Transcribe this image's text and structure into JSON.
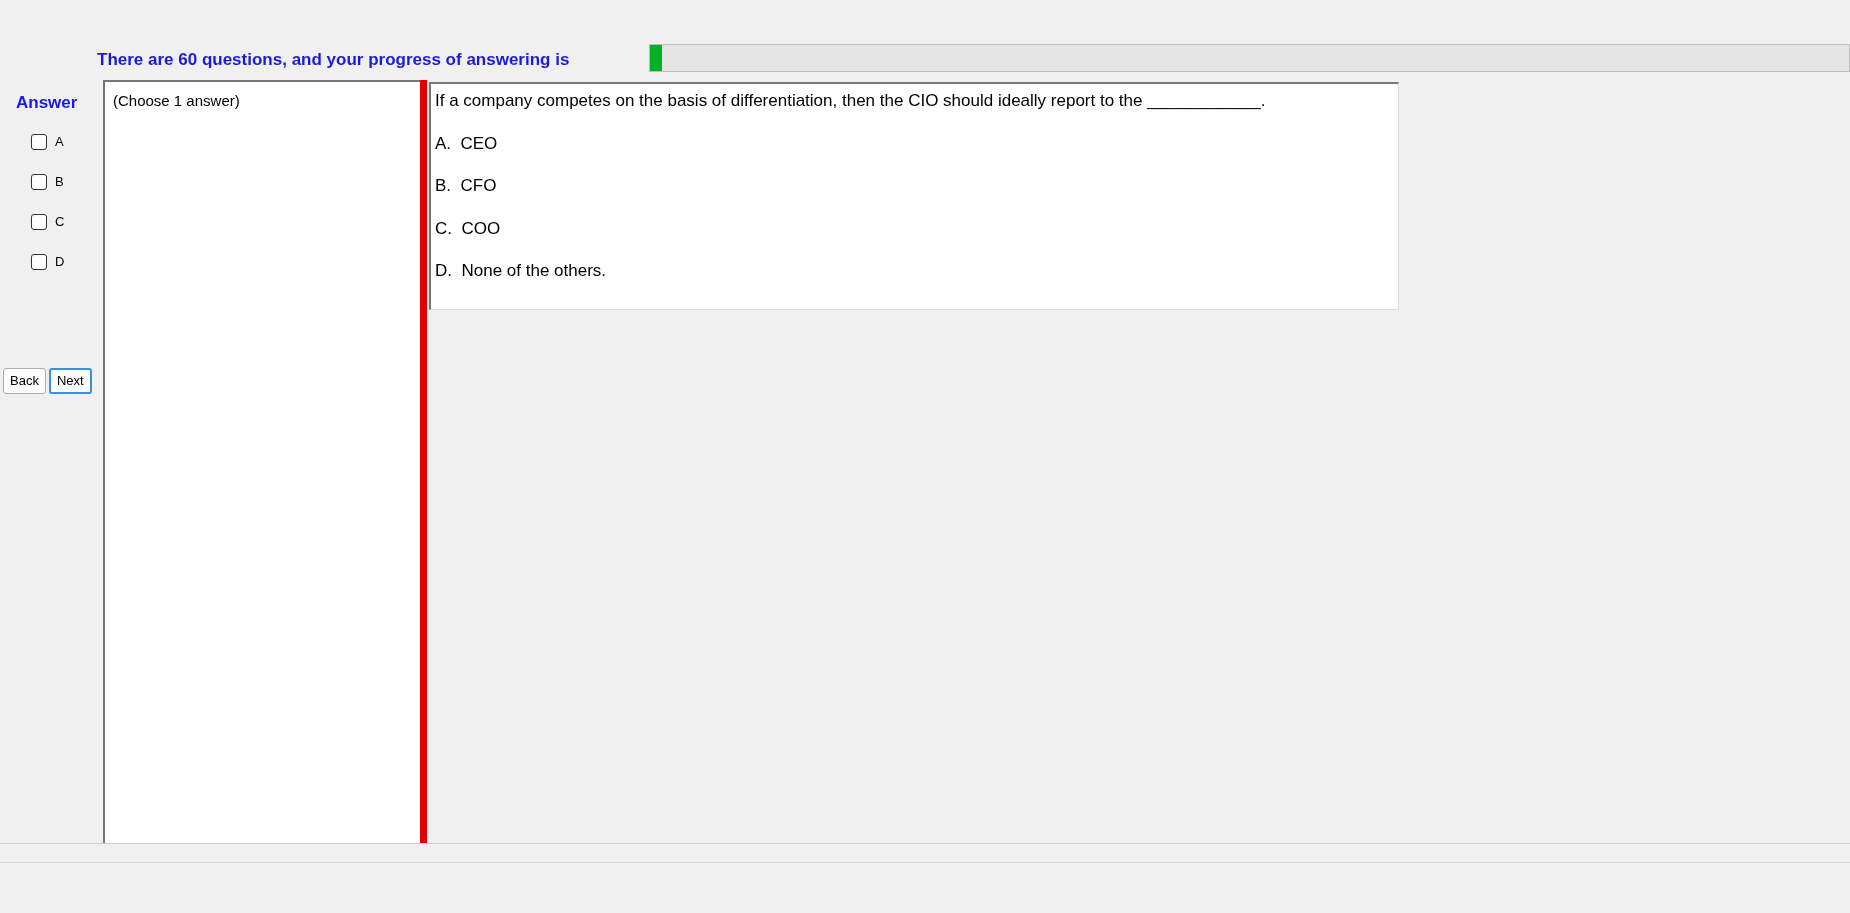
{
  "progress": {
    "label": "There are 60 questions, and your progress of answering is",
    "level": 0.01
  },
  "answer": {
    "title": "Answer",
    "options": [
      {
        "label": "A",
        "checked": false
      },
      {
        "label": "B",
        "checked": false
      },
      {
        "label": "C",
        "checked": false
      },
      {
        "label": "D",
        "checked": false
      }
    ]
  },
  "buttons": [
    {
      "label": "Back",
      "selected": false
    },
    {
      "label": "Next",
      "selected": true
    }
  ],
  "instruction": "(Choose 1 answer)",
  "question": {
    "text": "If a company competes on the basis of differentiation, then the CIO should ideally report to the ____________.",
    "choices": [
      "A.  CEO",
      "B.  CFO",
      "C.  COO",
      "D.  None of the others."
    ]
  }
}
